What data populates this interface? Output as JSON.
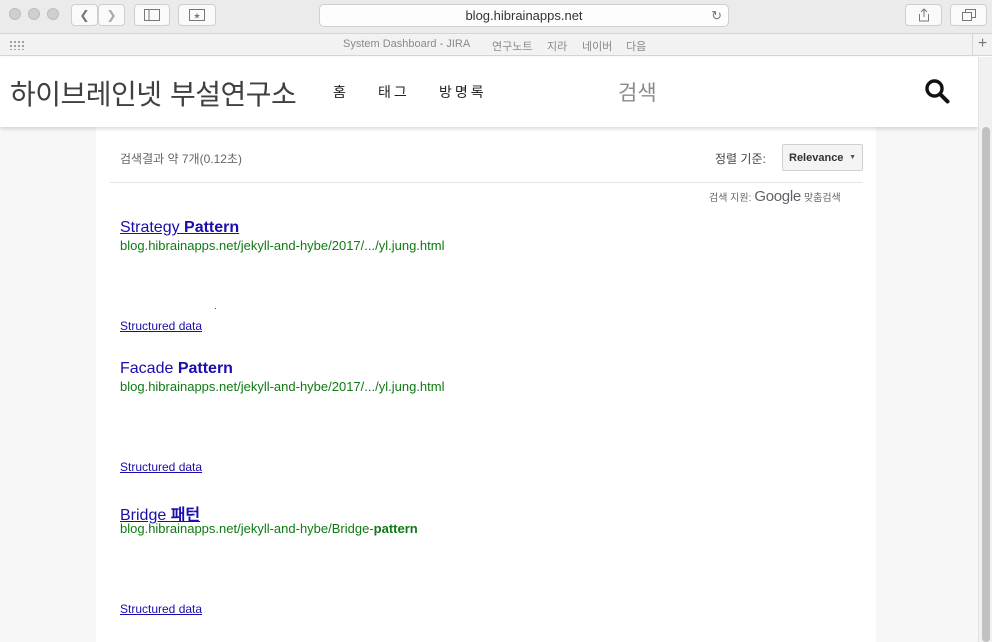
{
  "browser": {
    "url": "blog.hibrainapps.net",
    "favorites": [
      "System Dashboard - JIRA",
      "연구노트",
      "지라",
      "네이버",
      "다음"
    ]
  },
  "site": {
    "title": "하이브레인넷 부설연구소",
    "nav": [
      "홈",
      "태그",
      "방명록"
    ],
    "search_label": "검색"
  },
  "search": {
    "result_info": "검색결과 약 7개(0.12초)",
    "sort_label": "정렬 기준:",
    "sort_value": "Relevance",
    "powered_prefix": "검색 지원:",
    "powered_brand": "Google",
    "powered_suffix": "맞춤검색"
  },
  "results": [
    {
      "title_plain": "Strategy ",
      "title_bold": "Pattern",
      "url_plain": "blog.hibrainapps.net/jekyll-and-hybe/2017/.../yl.jung.html",
      "url_bold": "",
      "structured": "Structured data"
    },
    {
      "title_plain": "Facade ",
      "title_bold": "Pattern",
      "url_plain": "blog.hibrainapps.net/jekyll-and-hybe/2017/.../yl.jung.html",
      "url_bold": "",
      "structured": "Structured data"
    },
    {
      "title_plain": "Bridge ",
      "title_bold": "패턴",
      "url_plain": "blog.hibrainapps.net/jekyll-and-hybe/Bridge-",
      "url_bold": "pattern",
      "structured": "Structured data"
    }
  ],
  "colors": {
    "link": "#1a0dab",
    "url_green": "#0e7a12",
    "title_gray": "#404040"
  }
}
